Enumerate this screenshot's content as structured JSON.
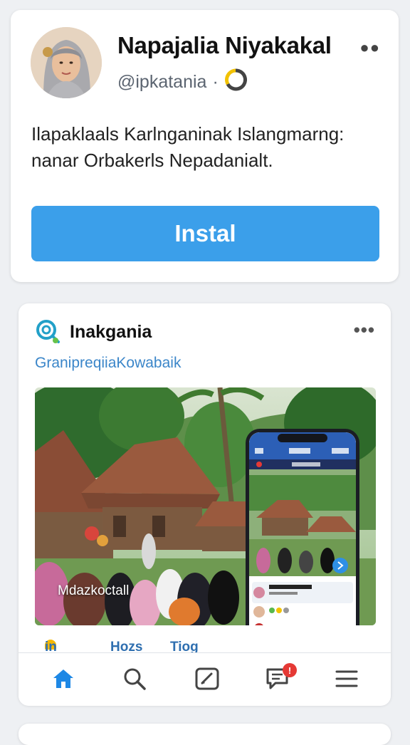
{
  "profile": {
    "name": "Napajalia Niyakakal",
    "handle": "@ipkatania",
    "bio": "Ilapaklaals Karlnganinak Islangmarng: nanar Orbakerls Nepadanialt.",
    "install_label": "Instal",
    "more_icon": "more-horizontal-icon"
  },
  "app": {
    "name": "Inakgania",
    "subtitle": "GranipreqiiaKowabaik",
    "photo_caption": "Mdazkoctall",
    "tabs": [
      "in",
      "Hozs",
      "Tiog"
    ],
    "logo_icon": "search-magnifier-logo",
    "screen": {
      "nav_text": "Taqz arxf",
      "list_title": "Aba lab ab"
    }
  },
  "bottom_nav": {
    "items": [
      "home-icon",
      "search-icon",
      "edit-icon",
      "messages-icon",
      "menu-icon"
    ],
    "messages_badge": "!"
  },
  "colors": {
    "accent": "#3b9fea",
    "link": "#3b86c9",
    "badge": "#e53935"
  }
}
